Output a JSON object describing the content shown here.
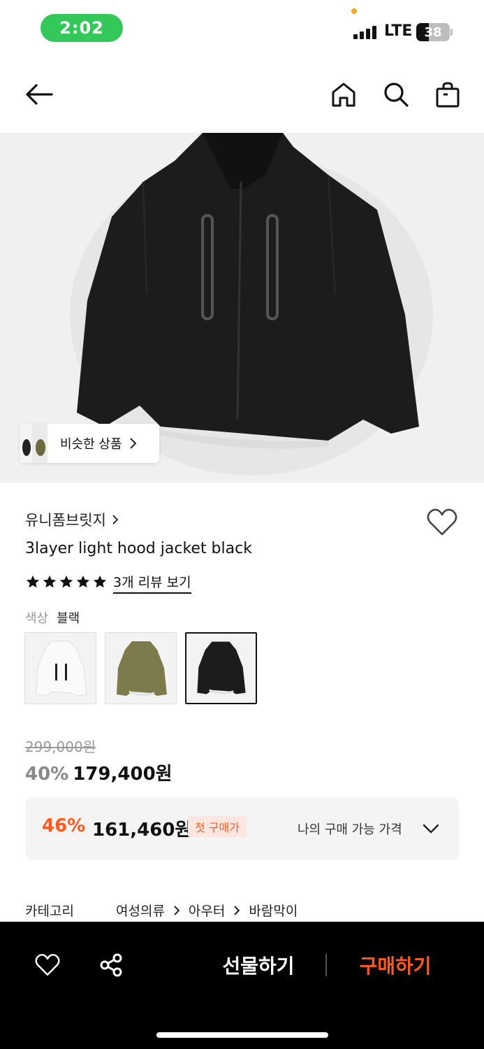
{
  "status_bar": {
    "time": "2:02",
    "network": "LTE",
    "battery": "38",
    "battery_level_percent": 38
  },
  "top_nav": {
    "back_icon": "arrow-left-icon",
    "home_icon": "home-icon",
    "search_icon": "search-icon",
    "bag_icon": "shopping-bag-icon"
  },
  "hero": {
    "similar_label": "비슷한 상품"
  },
  "product": {
    "brand": "유니폼브릿지",
    "title": "3layer light hood jacket black",
    "rating_stars": 5,
    "review_link": "3개 리뷰 보기",
    "color_label": "색상",
    "color_value": "블랙",
    "swatches": [
      {
        "color": "white",
        "selected": false
      },
      {
        "color": "khaki",
        "selected": false
      },
      {
        "color": "black",
        "selected": true
      }
    ]
  },
  "price": {
    "original": "299,000원",
    "discount": "40%",
    "sale": "179,400원"
  },
  "coupon": {
    "discount": "46%",
    "price": "161,460원",
    "badge": "첫 구매가",
    "my_price_label": "나의 구매 가능 가격"
  },
  "category": {
    "label": "카테고리",
    "path": [
      "여성의류",
      "아우터",
      "바람막이"
    ]
  },
  "bottom_bar": {
    "gift_label": "선물하기",
    "buy_label": "구매하기"
  },
  "colors": {
    "accent": "#ff5a1f",
    "status_green": "#34c759"
  }
}
